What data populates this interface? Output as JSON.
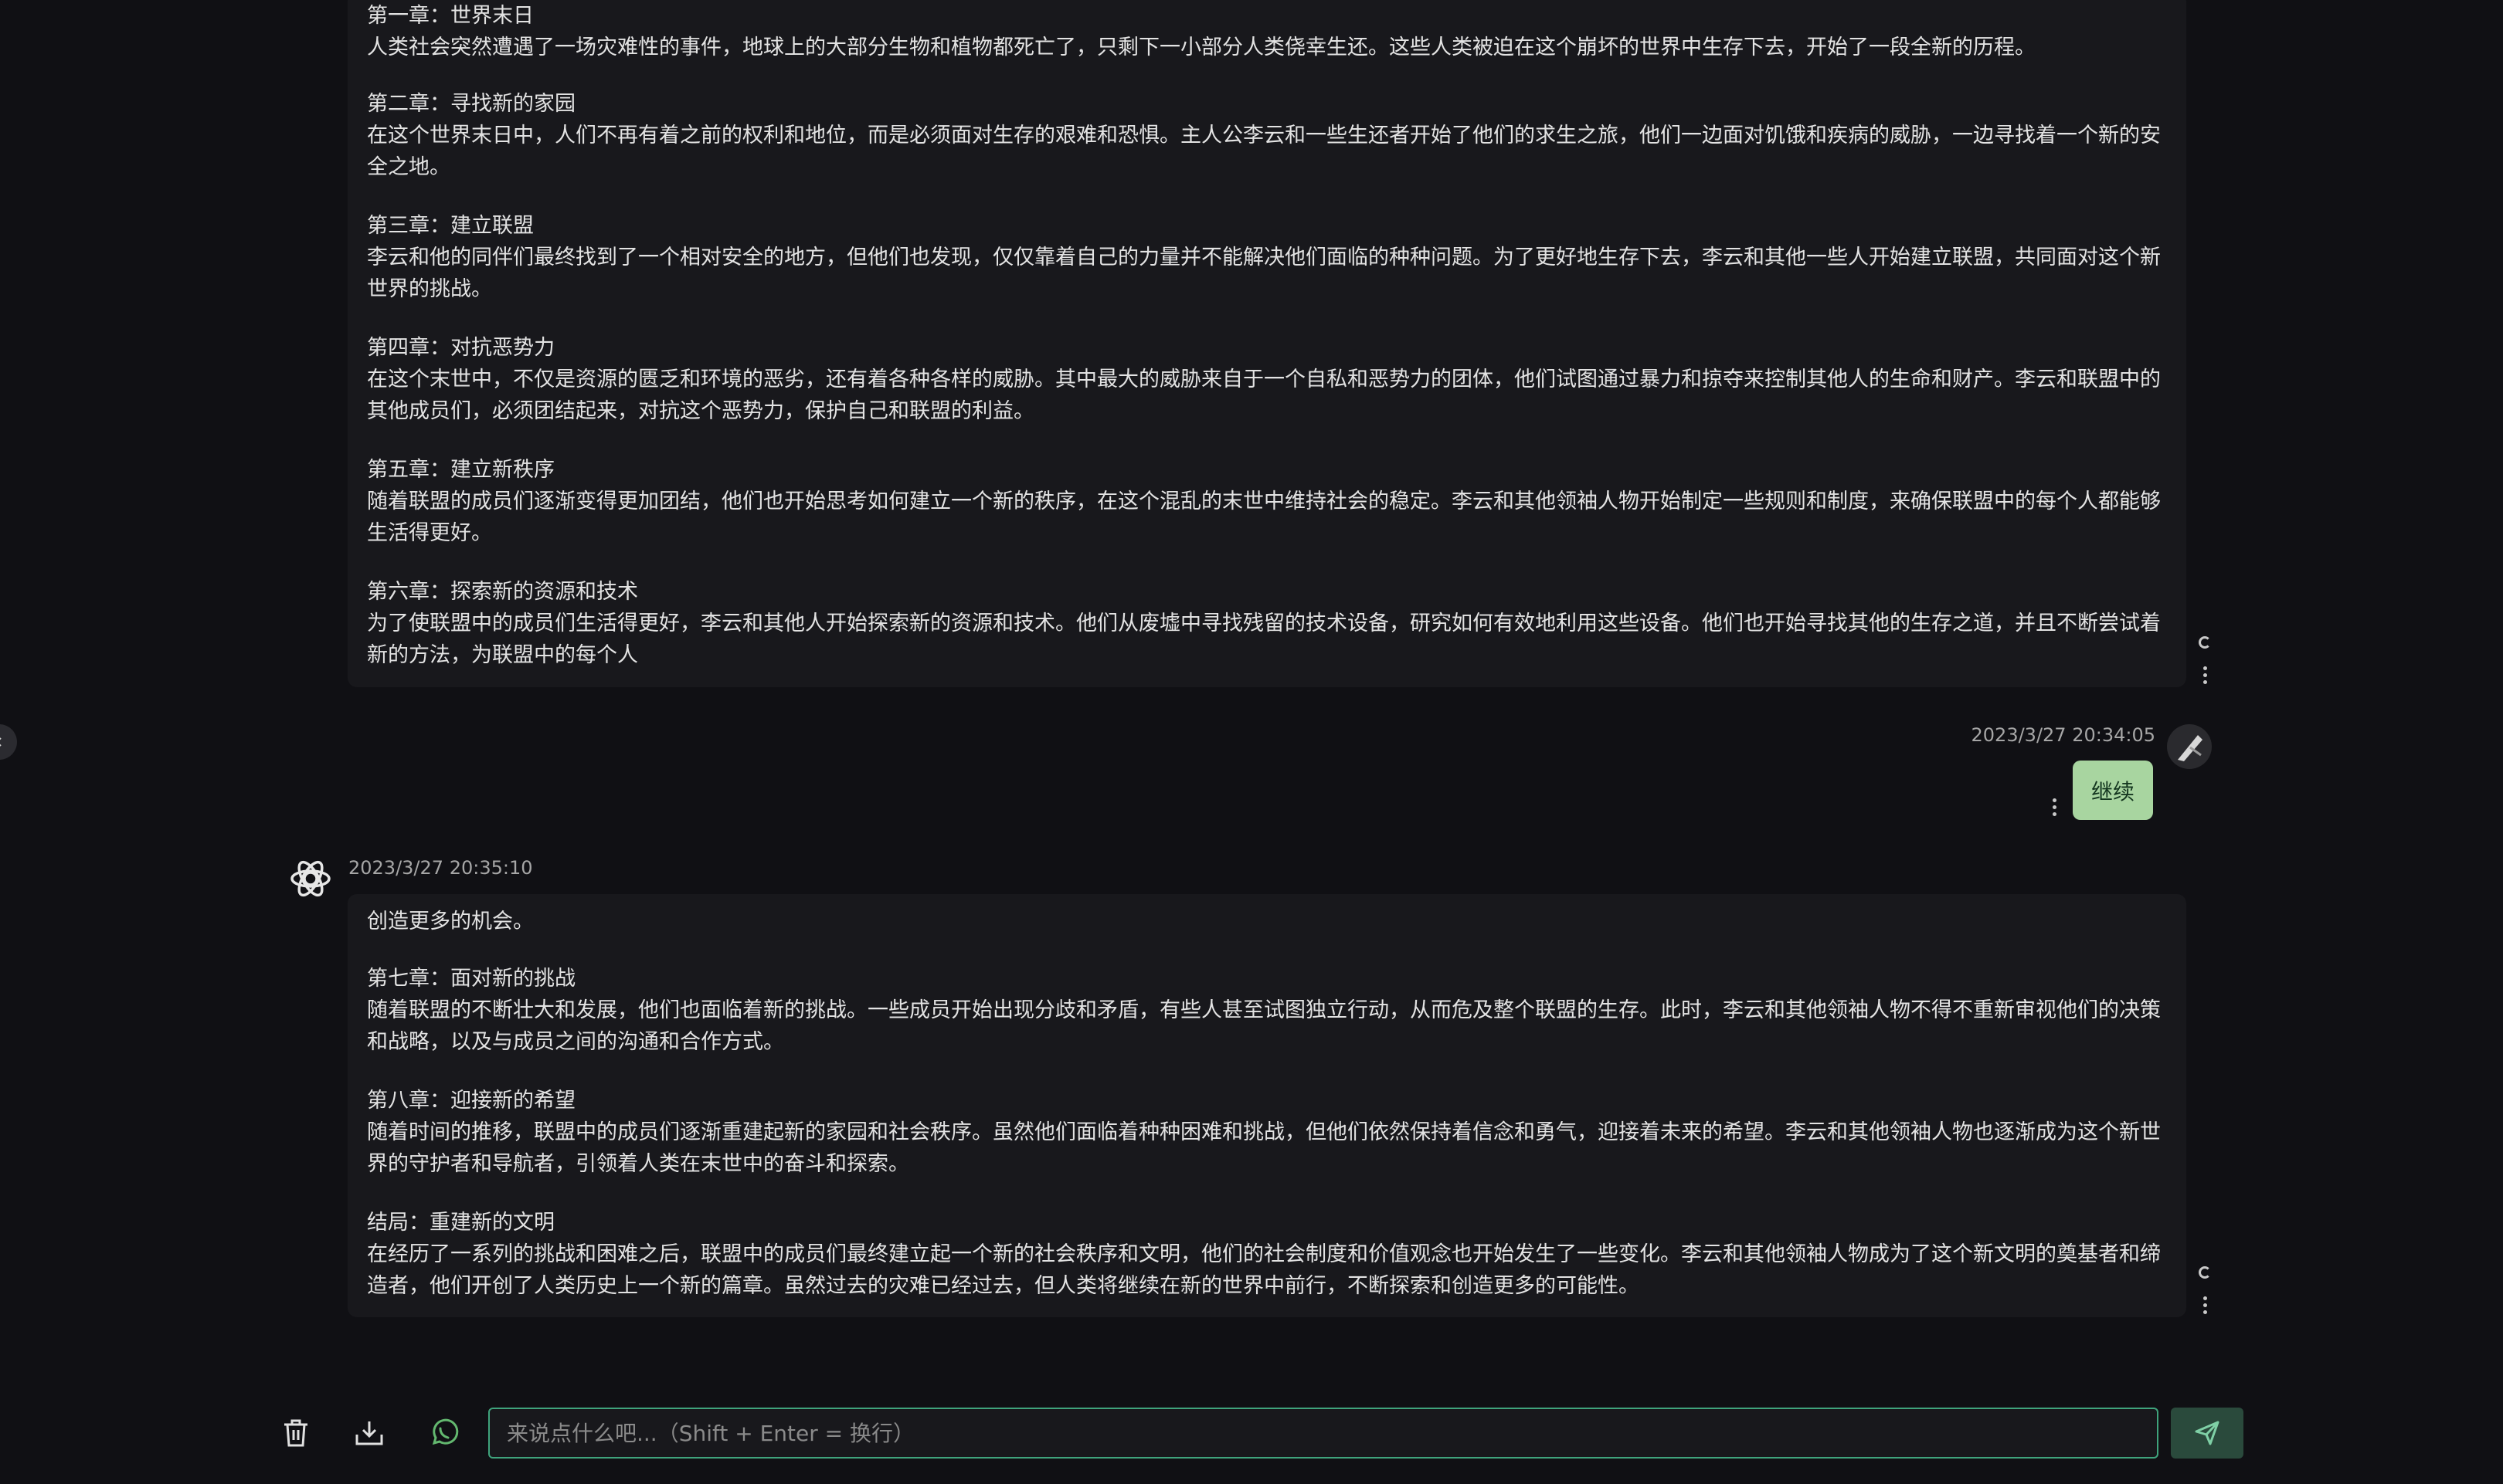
{
  "messages": [
    {
      "role": "assistant",
      "chapters": [
        {
          "title": "第一章：世界末日",
          "body": "人类社会突然遭遇了一场灾难性的事件，地球上的大部分生物和植物都死亡了，只剩下一小部分人类侥幸生还。这些人类被迫在这个崩坏的世界中生存下去，开始了一段全新的历程。"
        },
        {
          "title": "第二章：寻找新的家园",
          "body": "在这个世界末日中，人们不再有着之前的权利和地位，而是必须面对生存的艰难和恐惧。主人公李云和一些生还者开始了他们的求生之旅，他们一边面对饥饿和疾病的威胁，一边寻找着一个新的安全之地。"
        },
        {
          "title": "第三章：建立联盟",
          "body": "李云和他的同伴们最终找到了一个相对安全的地方，但他们也发现，仅仅靠着自己的力量并不能解决他们面临的种种问题。为了更好地生存下去，李云和其他一些人开始建立联盟，共同面对这个新世界的挑战。"
        },
        {
          "title": "第四章：对抗恶势力",
          "body": "在这个末世中，不仅是资源的匮乏和环境的恶劣，还有着各种各样的威胁。其中最大的威胁来自于一个自私和恶势力的团体，他们试图通过暴力和掠夺来控制其他人的生命和财产。李云和联盟中的其他成员们，必须团结起来，对抗这个恶势力，保护自己和联盟的利益。"
        },
        {
          "title": "第五章：建立新秩序",
          "body": "随着联盟的成员们逐渐变得更加团结，他们也开始思考如何建立一个新的秩序，在这个混乱的末世中维持社会的稳定。李云和其他领袖人物开始制定一些规则和制度，来确保联盟中的每个人都能够生活得更好。"
        },
        {
          "title": "第六章：探索新的资源和技术",
          "body": "为了使联盟中的成员们生活得更好，李云和其他人开始探索新的资源和技术。他们从废墟中寻找残留的技术设备，研究如何有效地利用这些设备。他们也开始寻找其他的生存之道，并且不断尝试着新的方法，为联盟中的每个人"
        }
      ]
    },
    {
      "role": "user",
      "timestamp": "2023/3/27 20:34:05",
      "text": "继续"
    },
    {
      "role": "assistant",
      "timestamp": "2023/3/27 20:35:10",
      "intro": "创造更多的机会。",
      "chapters": [
        {
          "title": "第七章：面对新的挑战",
          "body": "随着联盟的不断壮大和发展，他们也面临着新的挑战。一些成员开始出现分歧和矛盾，有些人甚至试图独立行动，从而危及整个联盟的生存。此时，李云和其他领袖人物不得不重新审视他们的决策和战略，以及与成员之间的沟通和合作方式。"
        },
        {
          "title": "第八章：迎接新的希望",
          "body": "随着时间的推移，联盟中的成员们逐渐重建起新的家园和社会秩序。虽然他们面临着种种困难和挑战，但他们依然保持着信念和勇气，迎接着未来的希望。李云和其他领袖人物也逐渐成为这个新世界的守护者和导航者，引领着人类在末世中的奋斗和探索。"
        },
        {
          "title": "结局：重建新的文明",
          "body": "在经历了一系列的挑战和困难之后，联盟中的成员们最终建立起一个新的社会秩序和文明，他们的社会制度和价值观念也开始发生了一些变化。李云和其他领袖人物成为了这个新文明的奠基者和缔造者，他们开创了人类历史上一个新的篇章。虽然过去的灾难已经过去，但人类将继续在新的世界中前行，不断探索和创造更多的可能性。"
        }
      ]
    }
  ],
  "input": {
    "placeholder": "来说点什么吧...（Shift + Enter = 换行）",
    "value": ""
  },
  "toolbar": {
    "icons": [
      "trash-icon",
      "download-icon",
      "whatsapp-icon"
    ]
  },
  "colors": {
    "background": "#101014",
    "bubble": "#18181c",
    "user_bubble": "#a8d5a0",
    "accent": "#3fa37c"
  }
}
